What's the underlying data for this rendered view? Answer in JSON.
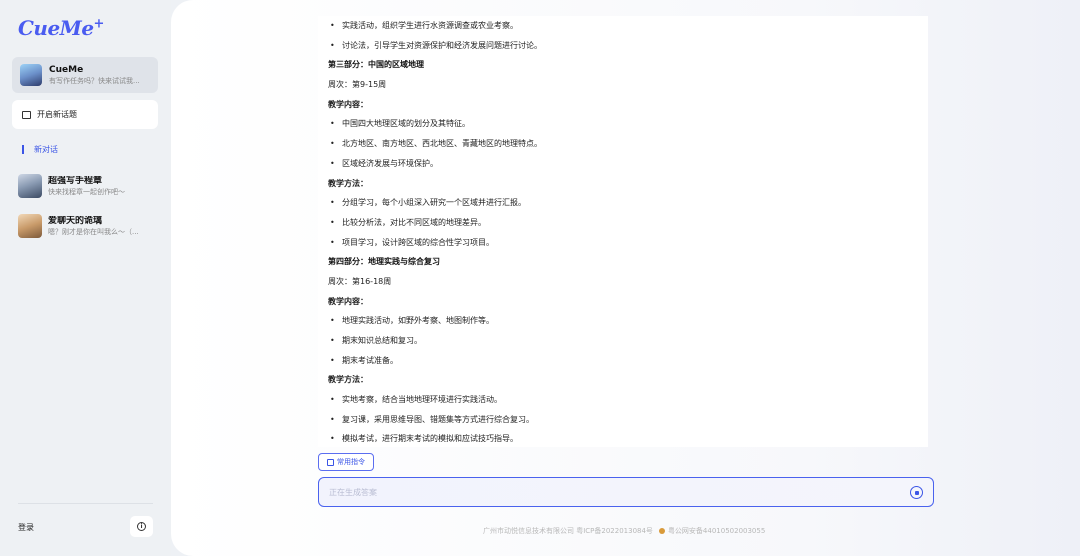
{
  "app": {
    "logo": "CueMe",
    "logo_plus": "+"
  },
  "sidebar": {
    "active_bot": {
      "name": "CueMe",
      "subtitle": "有写作任务吗？快来试试我..."
    },
    "new_topic_label": "开启新话题",
    "new_chat_label": "新对话",
    "agents": [
      {
        "name": "超强写手程章",
        "subtitle": "快来找程章一起创作吧～"
      },
      {
        "name": "爱聊天的诡璃",
        "subtitle": "嗯？刚才是你在叫我么～（..."
      }
    ],
    "login_label": "登录",
    "info_icon": "i"
  },
  "content": {
    "lines": [
      {
        "type": "bullet",
        "text": "实践活动，组织学生进行水资源调查或农业考察。"
      },
      {
        "type": "bullet",
        "text": "讨论法，引导学生对资源保护和经济发展问题进行讨论。"
      },
      {
        "type": "heading",
        "text": "第三部分：中国的区域地理"
      },
      {
        "type": "plain",
        "text": "周次：第9-15周"
      },
      {
        "type": "label",
        "text": "教学内容："
      },
      {
        "type": "bullet",
        "text": "中国四大地理区域的划分及其特征。"
      },
      {
        "type": "bullet",
        "text": "北方地区、南方地区、西北地区、青藏地区的地理特点。"
      },
      {
        "type": "bullet",
        "text": "区域经济发展与环境保护。"
      },
      {
        "type": "label",
        "text": "教学方法："
      },
      {
        "type": "bullet",
        "text": "分组学习，每个小组深入研究一个区域并进行汇报。"
      },
      {
        "type": "bullet",
        "text": "比较分析法，对比不同区域的地理差异。"
      },
      {
        "type": "bullet",
        "text": "项目学习，设计跨区域的综合性学习项目。"
      },
      {
        "type": "heading",
        "text": "第四部分：地理实践与综合复习"
      },
      {
        "type": "plain",
        "text": "周次：第16-18周"
      },
      {
        "type": "label",
        "text": "教学内容："
      },
      {
        "type": "bullet",
        "text": "地理实践活动，如野外考察、地图制作等。"
      },
      {
        "type": "bullet",
        "text": "期末知识总结和复习。"
      },
      {
        "type": "bullet",
        "text": "期末考试准备。"
      },
      {
        "type": "label",
        "text": "教学方法："
      },
      {
        "type": "bullet",
        "text": "实地考察，结合当地地理环境进行实践活动。"
      },
      {
        "type": "bullet",
        "text": "复习课，采用思维导图、错题集等方式进行综合复习。"
      },
      {
        "type": "bullet",
        "text": "模拟考试，进行期末考试的模拟和应试技巧指导。"
      }
    ]
  },
  "composer": {
    "commands_label": "常用指令",
    "placeholder": "正在生成答案"
  },
  "footer": {
    "company": "广州市动悦信息技术有限公司 粤ICP备2022013084号",
    "police": "粤公网安备44010502003055"
  },
  "colors": {
    "accent": "#3b55e6",
    "sidebar_bg": "#eef1f4"
  }
}
